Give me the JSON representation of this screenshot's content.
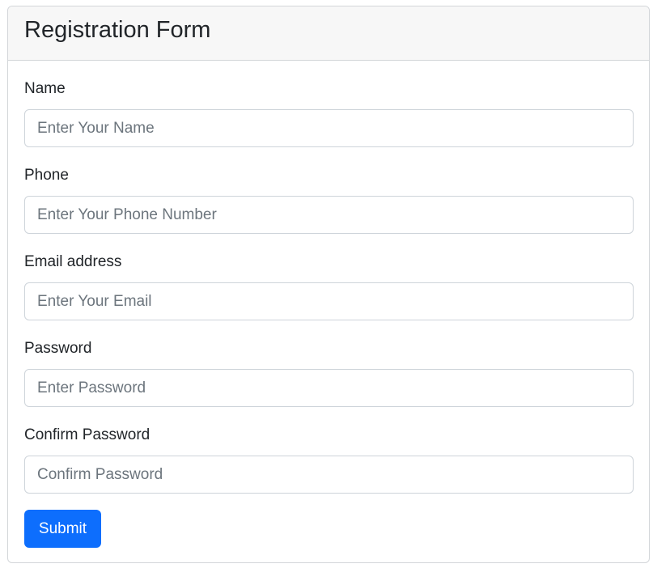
{
  "form": {
    "title": "Registration Form",
    "fields": [
      {
        "label": "Name",
        "placeholder": "Enter Your Name",
        "value": ""
      },
      {
        "label": "Phone",
        "placeholder": "Enter Your Phone Number",
        "value": ""
      },
      {
        "label": "Email address",
        "placeholder": "Enter Your Email",
        "value": ""
      },
      {
        "label": "Password",
        "placeholder": "Enter Password",
        "value": ""
      },
      {
        "label": "Confirm Password",
        "placeholder": "Confirm Password",
        "value": ""
      }
    ],
    "submit_label": "Submit"
  },
  "colors": {
    "primary": "#0d6efd",
    "header_bg": "#f7f7f7",
    "border": "#d3d6d9",
    "placeholder": "#6c757d",
    "text": "#212529"
  }
}
